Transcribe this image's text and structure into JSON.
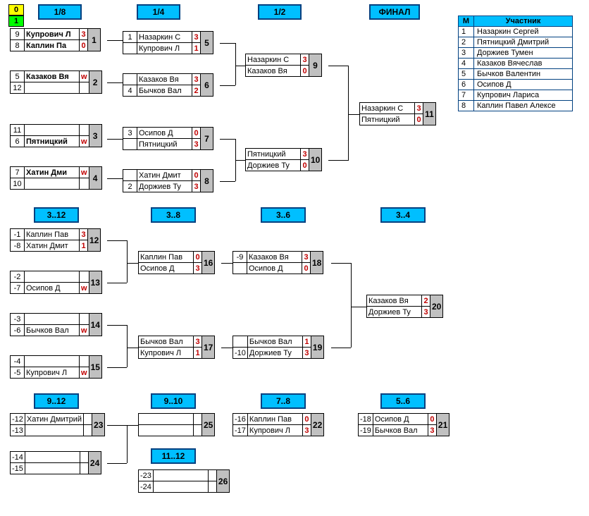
{
  "corner": {
    "top": "0",
    "bot": "1"
  },
  "headers": {
    "r18": "1/8",
    "r14": "1/4",
    "r12": "1/2",
    "final": "ФИНАЛ",
    "b312": "3..12",
    "b38": "3..8",
    "b36": "3..6",
    "b34": "3..4",
    "b912": "9..12",
    "b910": "9..10",
    "b78": "7..8",
    "b56": "5..6",
    "b1112": "11..12"
  },
  "participants": {
    "col_m": "М",
    "col_name": "Участник",
    "rows": [
      {
        "m": "1",
        "n": "Назаркин Сергей"
      },
      {
        "m": "2",
        "n": "Пятницкий Дмитрий"
      },
      {
        "m": "3",
        "n": "Доржиев Тумен"
      },
      {
        "m": "4",
        "n": "Казаков Вячеслав"
      },
      {
        "m": "5",
        "n": "Бычков Валентин"
      },
      {
        "m": "6",
        "n": "Осипов Д"
      },
      {
        "m": "7",
        "n": "Купрович Лариса"
      },
      {
        "m": "8",
        "n": "Каплин Павел Алексе"
      }
    ]
  },
  "m": {
    "1": {
      "a": {
        "s": "9",
        "n": "Купрович Л",
        "sc": "3",
        "b": true
      },
      "b": {
        "s": "8",
        "n": "Каплин Па",
        "sc": "0",
        "b": true
      },
      "num": "1"
    },
    "2": {
      "a": {
        "s": "5",
        "n": "Казаков Вя",
        "sc": "w",
        "b": true
      },
      "b": {
        "s": "12",
        "n": "",
        "sc": ""
      },
      "num": "2"
    },
    "3": {
      "a": {
        "s": "11",
        "n": "",
        "sc": ""
      },
      "b": {
        "s": "6",
        "n": "Пятницкий",
        "sc": "w",
        "b": true
      },
      "num": "3"
    },
    "4": {
      "a": {
        "s": "7",
        "n": "Хатин Дми",
        "sc": "w",
        "b": true
      },
      "b": {
        "s": "10",
        "n": "",
        "sc": ""
      },
      "num": "4"
    },
    "5": {
      "a": {
        "s": "1",
        "n": "Назаркин С",
        "sc": "3"
      },
      "b": {
        "s": "",
        "n": "Купрович Л",
        "sc": "1"
      },
      "num": "5"
    },
    "6": {
      "a": {
        "s": "",
        "n": "Казаков Вя",
        "sc": "3"
      },
      "b": {
        "s": "4",
        "n": "Бычков Вал",
        "sc": "2"
      },
      "num": "6"
    },
    "7": {
      "a": {
        "s": "3",
        "n": "Осипов Д",
        "sc": "0"
      },
      "b": {
        "s": "",
        "n": "Пятницкий",
        "sc": "3"
      },
      "num": "7"
    },
    "8": {
      "a": {
        "s": "",
        "n": "Хатин Дмит",
        "sc": "0"
      },
      "b": {
        "s": "2",
        "n": "Доржиев Ту",
        "sc": "3"
      },
      "num": "8"
    },
    "9": {
      "a": {
        "s": "",
        "n": "Назаркин С",
        "sc": "3"
      },
      "b": {
        "s": "",
        "n": "Казаков Вя",
        "sc": "0"
      },
      "num": "9"
    },
    "10": {
      "a": {
        "s": "",
        "n": "Пятницкий",
        "sc": "3"
      },
      "b": {
        "s": "",
        "n": "Доржиев Ту",
        "sc": "0"
      },
      "num": "10"
    },
    "11": {
      "a": {
        "s": "",
        "n": "Назаркин С",
        "sc": "3"
      },
      "b": {
        "s": "",
        "n": "Пятницкий",
        "sc": "0"
      },
      "num": "11"
    },
    "12": {
      "a": {
        "s": "-1",
        "n": "Каплин Пав",
        "sc": "3"
      },
      "b": {
        "s": "-8",
        "n": "Хатин Дмит",
        "sc": "1"
      },
      "num": "12"
    },
    "13": {
      "a": {
        "s": "-2",
        "n": "",
        "sc": ""
      },
      "b": {
        "s": "-7",
        "n": "Осипов Д",
        "sc": "w"
      },
      "num": "13"
    },
    "14": {
      "a": {
        "s": "-3",
        "n": "",
        "sc": ""
      },
      "b": {
        "s": "-6",
        "n": "Бычков Вал",
        "sc": "w"
      },
      "num": "14"
    },
    "15": {
      "a": {
        "s": "-4",
        "n": "",
        "sc": ""
      },
      "b": {
        "s": "-5",
        "n": "Купрович Л",
        "sc": "w"
      },
      "num": "15"
    },
    "16": {
      "a": {
        "s": "",
        "n": "Каплин Пав",
        "sc": "0"
      },
      "b": {
        "s": "",
        "n": "Осипов Д",
        "sc": "3"
      },
      "num": "16"
    },
    "17": {
      "a": {
        "s": "",
        "n": "Бычков Вал",
        "sc": "3"
      },
      "b": {
        "s": "",
        "n": "Купрович Л",
        "sc": "1"
      },
      "num": "17"
    },
    "18": {
      "a": {
        "s": "-9",
        "n": "Казаков Вя",
        "sc": "3"
      },
      "b": {
        "s": "",
        "n": "Осипов Д",
        "sc": "0"
      },
      "num": "18"
    },
    "19": {
      "a": {
        "s": "",
        "n": "Бычков Вал",
        "sc": "1"
      },
      "b": {
        "s": "-10",
        "n": "Доржиев Ту",
        "sc": "3"
      },
      "num": "19"
    },
    "20": {
      "a": {
        "s": "",
        "n": "Казаков Вя",
        "sc": "2"
      },
      "b": {
        "s": "",
        "n": "Доржиев Ту",
        "sc": "3"
      },
      "num": "20"
    },
    "21": {
      "a": {
        "s": "-18",
        "n": "Осипов Д",
        "sc": "0"
      },
      "b": {
        "s": "-19",
        "n": "Бычков Вал",
        "sc": "3"
      },
      "num": "21"
    },
    "22": {
      "a": {
        "s": "-16",
        "n": "Каплин Пав",
        "sc": "0"
      },
      "b": {
        "s": "-17",
        "n": "Купрович Л",
        "sc": "3"
      },
      "num": "22"
    },
    "23": {
      "a": {
        "s": "-12",
        "n": "Хатин Дмитрий",
        "sc": ""
      },
      "b": {
        "s": "-13",
        "n": "",
        "sc": ""
      },
      "num": "23"
    },
    "24": {
      "a": {
        "s": "-14",
        "n": "",
        "sc": ""
      },
      "b": {
        "s": "-15",
        "n": "",
        "sc": ""
      },
      "num": "24"
    },
    "25": {
      "a": {
        "s": "",
        "n": "",
        "sc": ""
      },
      "b": {
        "s": "",
        "n": "",
        "sc": ""
      },
      "num": "25"
    },
    "26": {
      "a": {
        "s": "-23",
        "n": "",
        "sc": ""
      },
      "b": {
        "s": "-24",
        "n": "",
        "sc": ""
      },
      "num": "26"
    }
  }
}
